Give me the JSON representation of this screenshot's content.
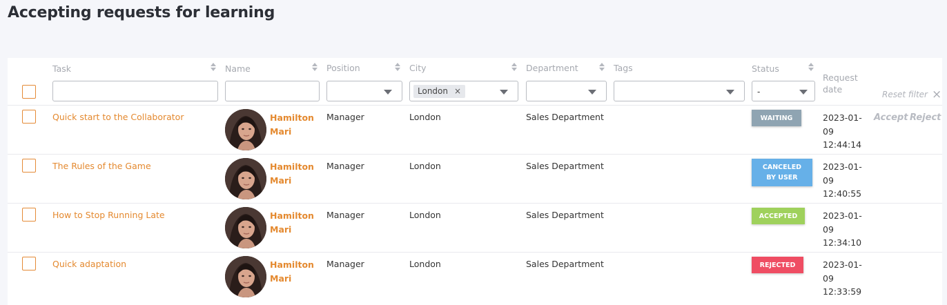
{
  "page": {
    "title": "Accepting requests for learning"
  },
  "columns": {
    "task": "Task",
    "name": "Name",
    "position": "Position",
    "city": "City",
    "department": "Department",
    "tags": "Tags",
    "status": "Status",
    "request_date": "Request date"
  },
  "filters": {
    "task": "",
    "name": "",
    "position": "",
    "city_chip": "London",
    "chip_remove": "×",
    "department": "",
    "tags": "",
    "status": "-",
    "reset_label": "Reset filter",
    "reset_icon": "×"
  },
  "actions": {
    "accept": "Accept",
    "reject": "Reject"
  },
  "status_colors": {
    "waiting": "#8fa4b2",
    "canceled": "#66b0e8",
    "accepted": "#9fd15c",
    "rejected": "#ef4d63"
  },
  "rows": [
    {
      "task": "Quick start to the Collaborator",
      "name_last": "Hamilton",
      "name_first": "Mari",
      "position": "Manager",
      "city": "London",
      "department": "Sales Department",
      "status_line1": "WAITING",
      "status_line2": "",
      "date_line1": "2023-01-",
      "date_line2": "09",
      "date_line3": "12:44:14"
    },
    {
      "task": "The Rules of the Game",
      "name_last": "Hamilton",
      "name_first": "Mari",
      "position": "Manager",
      "city": "London",
      "department": "Sales Department",
      "status_line1": "CANCELED",
      "status_line2": "BY USER",
      "date_line1": "2023-01-",
      "date_line2": "09",
      "date_line3": "12:40:55"
    },
    {
      "task": "How to Stop Running Late",
      "name_last": "Hamilton",
      "name_first": "Mari",
      "position": "Manager",
      "city": "London",
      "department": "Sales Department",
      "status_line1": "ACCEPTED",
      "status_line2": "",
      "date_line1": "2023-01-",
      "date_line2": "09",
      "date_line3": "12:34:10"
    },
    {
      "task": "Quick adaptation",
      "name_last": "Hamilton",
      "name_first": "Mari",
      "position": "Manager",
      "city": "London",
      "department": "Sales Department",
      "status_line1": "REJECTED",
      "status_line2": "",
      "date_line1": "2023-01-",
      "date_line2": "09",
      "date_line3": "12:33:59"
    }
  ]
}
